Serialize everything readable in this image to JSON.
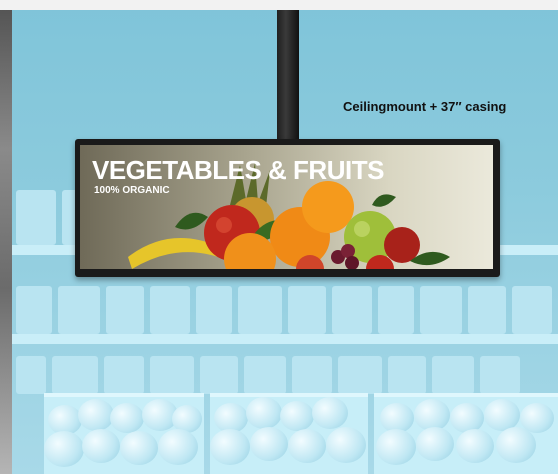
{
  "caption": "Ceilingmount + 37″ casing",
  "display": {
    "headline": "VEGETABLES & FRUITS",
    "subline": "100% ORGANIC"
  },
  "colors": {
    "background": "#8fc6d8",
    "display_frame": "#1a1a1a",
    "caption_text": "#111111",
    "headline_text": "#ffffff"
  }
}
